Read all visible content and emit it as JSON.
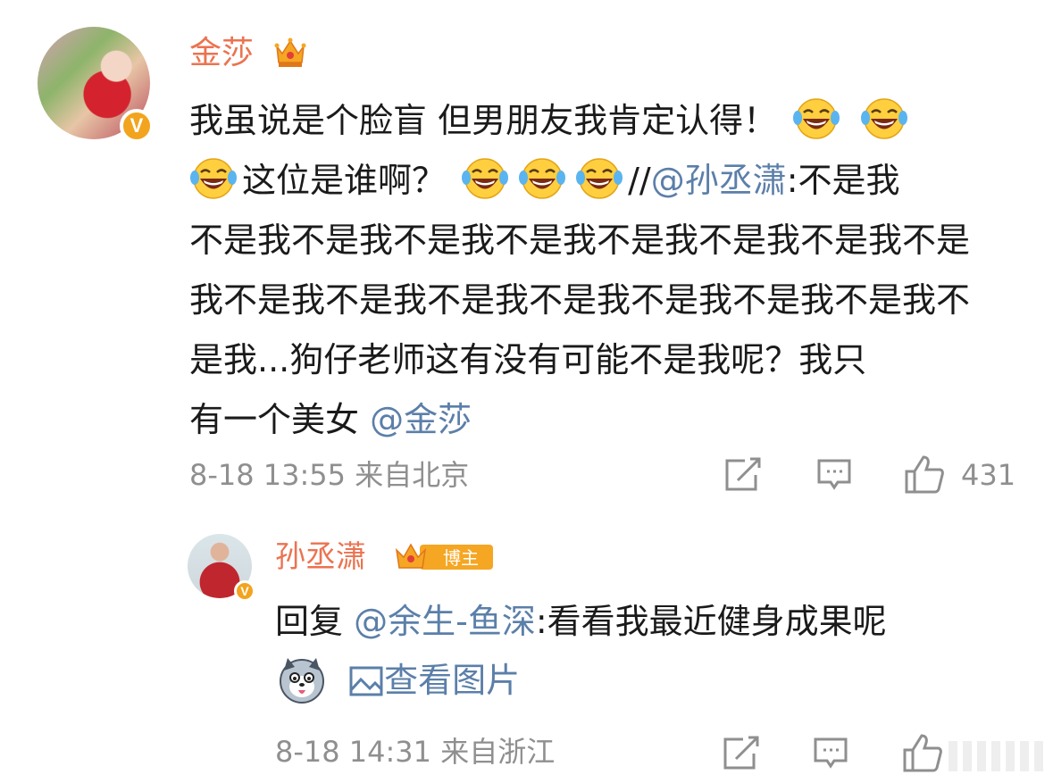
{
  "comment": {
    "author": "金莎",
    "lines": [
      [
        "我虽说是个脸盲 但男朋友我肯定认得！"
      ],
      [
        "这位是谁啊？"
      ],
      [
        "不是我不是我不是我不是我不是我不是我不是我不是"
      ],
      [
        "我不是我不是我不是我不是我不是我不是我不是我不"
      ],
      [
        "是我...狗仔老师这有没有可能不是我呢？我只"
      ],
      [
        "有一个美女 "
      ]
    ],
    "repost_prefix": "//",
    "repost_mention": "@孙丞潇",
    "repost_text": ":不是我",
    "end_mention": "@金莎",
    "time": "8-18 13:55",
    "source": "来自北京",
    "like_count": "431",
    "emoji_name": "laugh-cry-emoji"
  },
  "reply": {
    "author": "孙丞潇",
    "badge_label": "博主",
    "prefix": "回复",
    "mention": "@余生-鱼深",
    "text": ":看看我最近健身成果呢",
    "view_image_label": "查看图片",
    "time": "8-18 14:31",
    "source": "来自浙江"
  },
  "icons": {
    "verified": "V",
    "share": "share-icon",
    "comment": "comment-icon",
    "like": "thumbs-up-icon",
    "image": "image-icon"
  },
  "colors": {
    "name": "#eb7350",
    "link": "#5b7fa9",
    "meta": "#8f8f8f",
    "verified": "#f2a41e"
  }
}
